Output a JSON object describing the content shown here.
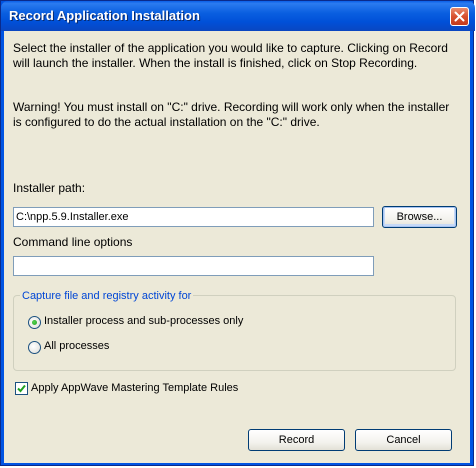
{
  "window": {
    "title": "Record Application Installation"
  },
  "content": {
    "instructions": "Select the installer of the application you would like to capture.  Clicking on Record will  launch the installer.  When the install is finished, click on Stop Recording.",
    "warning": "Warning! You must install on \"C:\" drive. Recording will work only when the installer is configured to do the actual installation on the \"C:\" drive."
  },
  "installer_path": {
    "label": "Installer path:",
    "value": "C:\\npp.5.9.Installer.exe",
    "browse_label": "Browse..."
  },
  "command_line": {
    "label": "Command line options",
    "value": ""
  },
  "capture_group": {
    "legend": "Capture file and registry activity for",
    "options": [
      {
        "label": "Installer process and sub-processes only",
        "selected": true
      },
      {
        "label": "All processes",
        "selected": false
      }
    ]
  },
  "template_rules": {
    "label": "Apply AppWave Mastering Template Rules",
    "checked": true
  },
  "footer": {
    "record_label": "Record",
    "cancel_label": "Cancel"
  },
  "colors": {
    "titlebar": "#0054e3",
    "dialog_bg": "#ece9d8",
    "group_legend": "#0046d5",
    "close_button": "#d8512f"
  },
  "icons": {
    "close": "close-icon",
    "check": "checkmark-icon"
  }
}
